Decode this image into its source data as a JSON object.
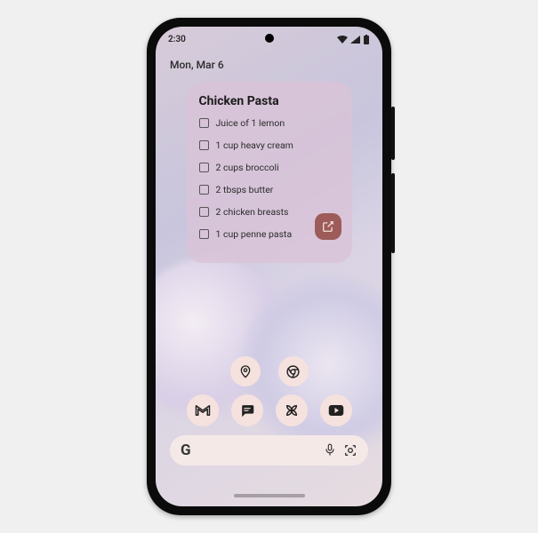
{
  "status": {
    "time": "2:30"
  },
  "date": "Mon, Mar 6",
  "widget": {
    "title": "Chicken Pasta",
    "items": [
      "Juice of 1 lemon",
      "1 cup heavy cream",
      "2 cups broccoli",
      "2 tbsps butter",
      "2 chicken breasts",
      "1 cup penne pasta"
    ]
  },
  "apps": {
    "row1": [
      "maps",
      "chrome"
    ],
    "row2": [
      "gmail",
      "messages",
      "photos-pinwheel",
      "youtube"
    ]
  },
  "search": {
    "logo": "G"
  },
  "colors": {
    "iconBg": "#f5e2de",
    "widgetBg": "#dac3d7",
    "actionBtn": "#9d5c59"
  }
}
